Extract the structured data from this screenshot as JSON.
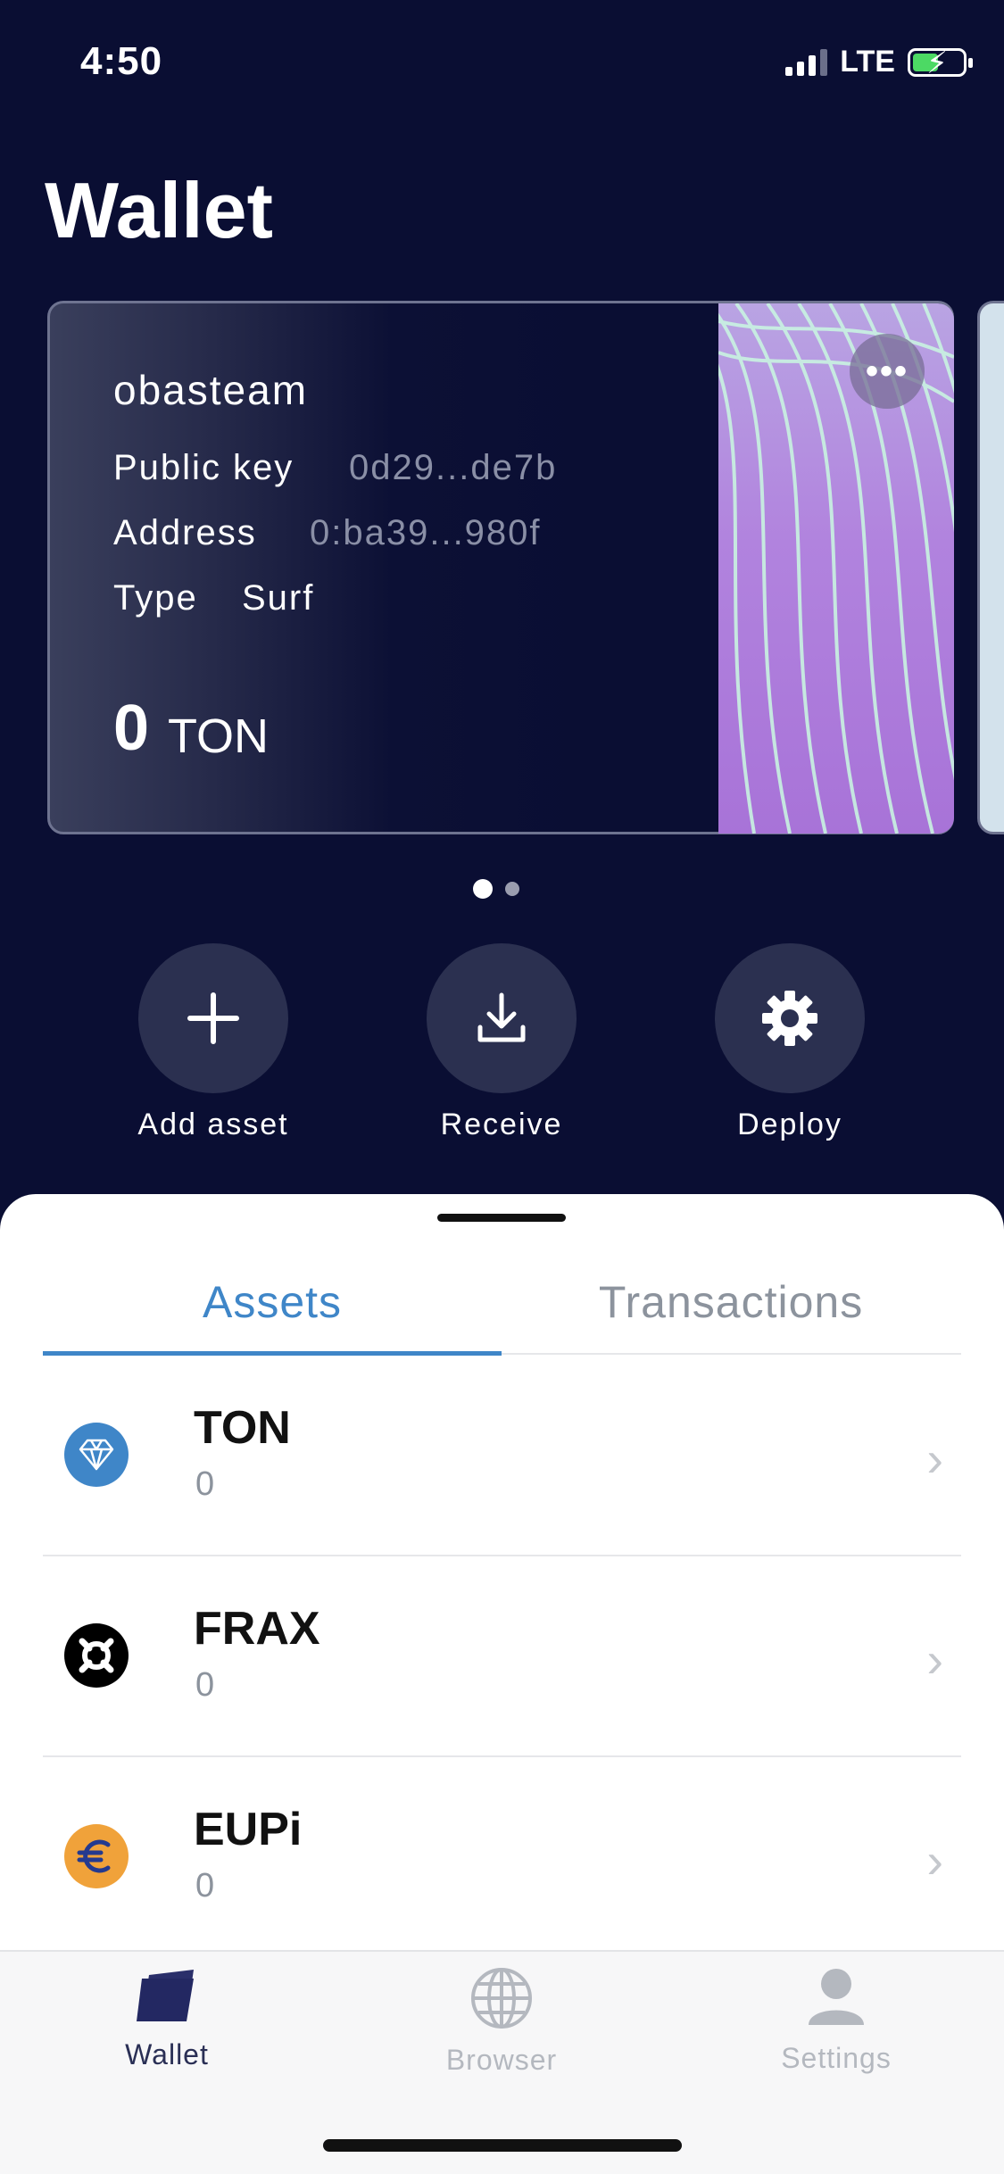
{
  "status_bar": {
    "time": "4:50",
    "network": "LTE"
  },
  "page_title": "Wallet",
  "card": {
    "name": "obasteam",
    "public_key_label": "Public key",
    "public_key": "0d29...de7b",
    "address_label": "Address",
    "address": "0:ba39...980f",
    "type_label": "Type",
    "type": "Surf",
    "balance": "0",
    "balance_unit": "TON",
    "menu_icon": "more-horizontal-icon"
  },
  "pager": {
    "count": 2,
    "active": 0
  },
  "actions": [
    {
      "label": "Add asset",
      "icon": "plus-icon"
    },
    {
      "label": "Receive",
      "icon": "download-icon"
    },
    {
      "label": "Deploy",
      "icon": "gear-icon"
    }
  ],
  "tabs": {
    "active": "Assets",
    "inactive": "Transactions"
  },
  "assets": [
    {
      "name": "TON",
      "amount": "0",
      "icon": "diamond-icon",
      "color": "#3f86c8"
    },
    {
      "name": "FRAX",
      "amount": "0",
      "icon": "frax-icon",
      "color": "#000000"
    },
    {
      "name": "EUPi",
      "amount": "0",
      "icon": "euro-icon",
      "color": "#f0a23a"
    }
  ],
  "tabbar": [
    {
      "label": "Wallet",
      "icon": "wallet-icon",
      "active": true
    },
    {
      "label": "Browser",
      "icon": "globe-icon",
      "active": false
    },
    {
      "label": "Settings",
      "icon": "user-icon",
      "active": false
    }
  ],
  "colors": {
    "background": "#0a0e33",
    "accent": "#3f86c8",
    "button": "#2b3050"
  }
}
